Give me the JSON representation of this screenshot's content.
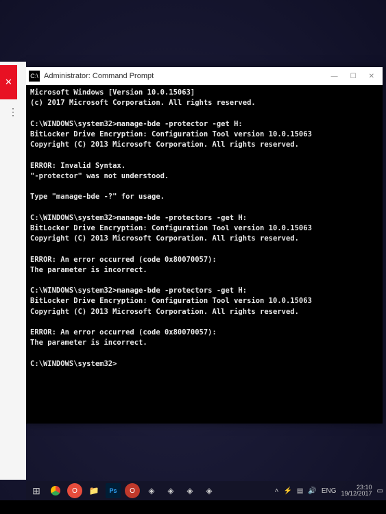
{
  "window": {
    "title": "Administrator: Command Prompt",
    "icon_label": "C:\\"
  },
  "terminal": {
    "lines": [
      "Microsoft Windows [Version 10.0.15063]",
      "(c) 2017 Microsoft Corporation. All rights reserved.",
      "",
      "C:\\WINDOWS\\system32>manage-bde -protector -get H:",
      "BitLocker Drive Encryption: Configuration Tool version 10.0.15063",
      "Copyright (C) 2013 Microsoft Corporation. All rights reserved.",
      "",
      "ERROR: Invalid Syntax.",
      "\"-protector\" was not understood.",
      "",
      "Type \"manage-bde -?\" for usage.",
      "",
      "C:\\WINDOWS\\system32>manage-bde -protectors -get H:",
      "BitLocker Drive Encryption: Configuration Tool version 10.0.15063",
      "Copyright (C) 2013 Microsoft Corporation. All rights reserved.",
      "",
      "ERROR: An error occurred (code 0x80070057):",
      "The parameter is incorrect.",
      "",
      "C:\\WINDOWS\\system32>manage-bde -protectors -get H:",
      "BitLocker Drive Encryption: Configuration Tool version 10.0.15063",
      "Copyright (C) 2013 Microsoft Corporation. All rights reserved.",
      "",
      "ERROR: An error occurred (code 0x80070057):",
      "The parameter is incorrect.",
      "",
      "C:\\WINDOWS\\system32>"
    ]
  },
  "left_panel": {
    "close_glyph": "✕",
    "dots": "⋮"
  },
  "title_controls": {
    "minimize": "—",
    "maximize": "☐",
    "close": "✕"
  },
  "taskbar": {
    "start_glyph": "⊞",
    "ps_label": "Ps",
    "opera_glyph": "O",
    "folder_glyph": "📁",
    "generic_glyph": "◈"
  },
  "tray": {
    "up_glyph": "˄",
    "battery_glyph": "⚡",
    "wifi_glyph": "▤",
    "vol_glyph": "🔊",
    "lang": "ENG",
    "clock_time": "23:10",
    "clock_date": "19/12/2017",
    "notif_glyph": "▭"
  }
}
